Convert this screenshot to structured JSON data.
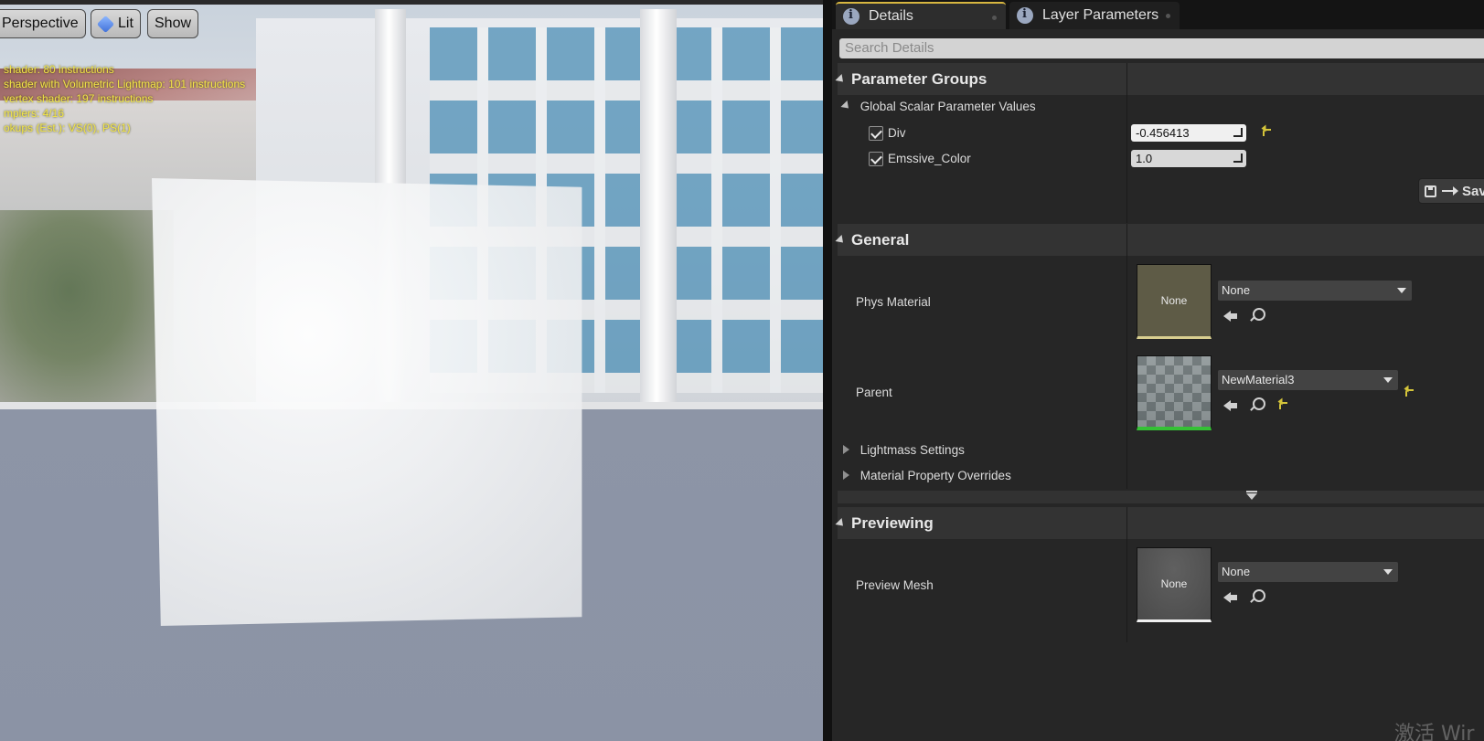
{
  "viewport": {
    "buttons": {
      "perspective": "Perspective",
      "lit": "Lit",
      "show": "Show"
    },
    "stats": [
      " shader: 80 instructions",
      " shader with Volumetric Lightmap: 101 instructions",
      " vertex shader: 197 instructions",
      "mplers: 4/16",
      "okups (Est.): VS(0), PS(1)"
    ],
    "stat_color": "#f3e548"
  },
  "panel": {
    "tabs": {
      "details": "Details",
      "layer": "Layer Parameters"
    },
    "search_placeholder": "Search Details",
    "parameter_groups": {
      "title": "Parameter Groups",
      "global_scalar": "Global Scalar Parameter Values",
      "params": [
        {
          "label": "Div",
          "value": "-0.456413",
          "checked": true
        },
        {
          "label": "Emssive_Color",
          "value": "1.0",
          "checked": true
        }
      ],
      "save_label": "Sav"
    },
    "general": {
      "title": "General",
      "phys_material": {
        "label": "Phys Material",
        "thumb": "None",
        "combo": "None"
      },
      "parent": {
        "label": "Parent",
        "combo": "NewMaterial3"
      },
      "lightmass": "Lightmass Settings",
      "overrides": "Material Property Overrides"
    },
    "previewing": {
      "title": "Previewing",
      "preview_mesh": {
        "label": "Preview Mesh",
        "thumb": "None",
        "combo": "None"
      }
    }
  },
  "watermark": "激活 Wir",
  "colors": {
    "accent_tab": "#d7b640",
    "reset_yellow": "#d4c43a",
    "parent_green": "#35c135"
  }
}
